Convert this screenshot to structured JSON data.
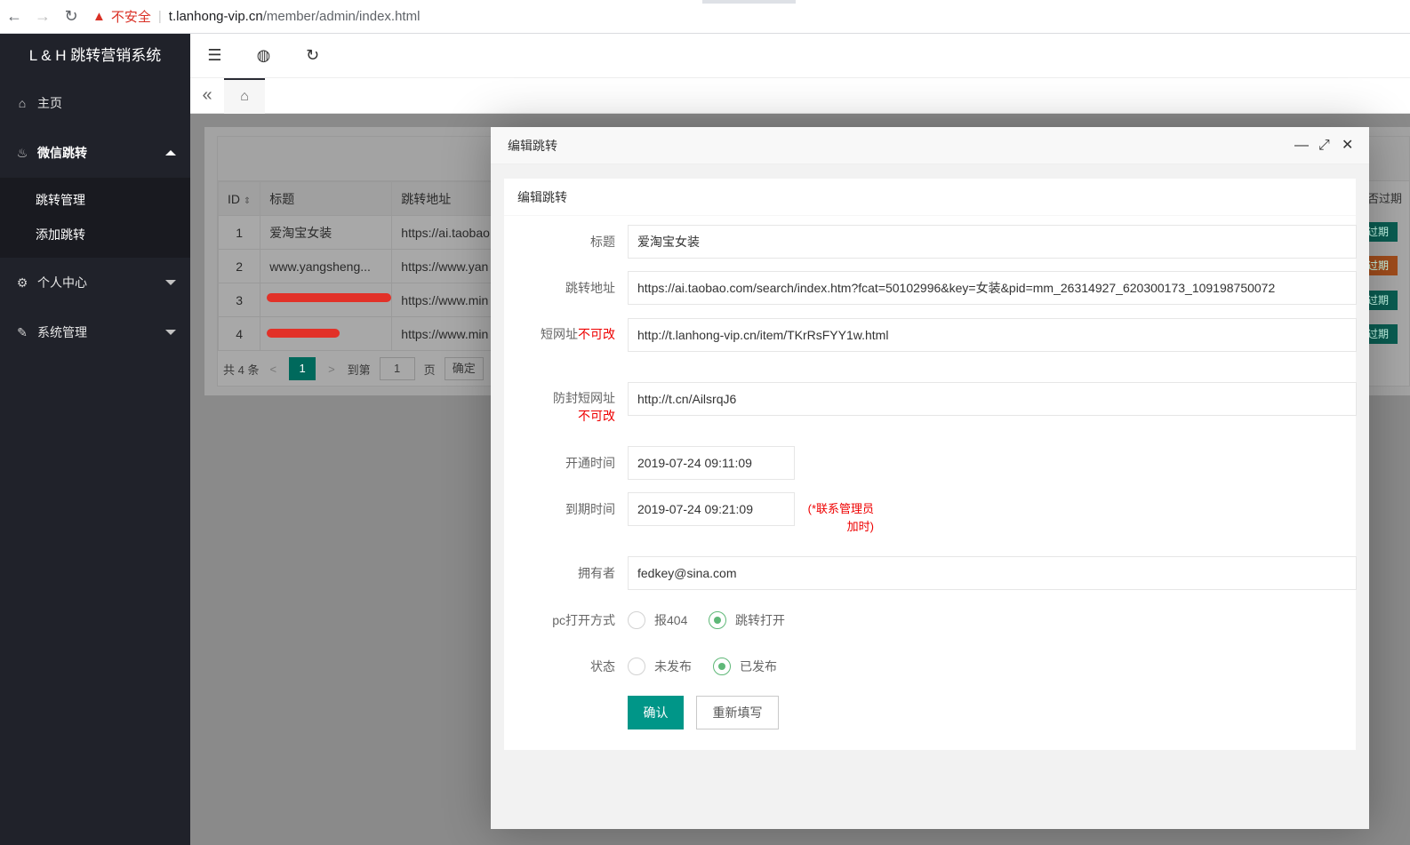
{
  "browser": {
    "back": "←",
    "forward": "→",
    "reload": "↻",
    "warning_icon": "▲",
    "insecure_label": "不安全",
    "host": "t.lanhong-vip.cn",
    "path": "/member/admin/index.html"
  },
  "sidebar": {
    "logo": "L & H 跳转营销系统",
    "items": [
      {
        "label": "主页",
        "icon": "home-icon"
      },
      {
        "label": "微信跳转",
        "icon": "fire-icon"
      },
      {
        "label": "个人中心",
        "icon": "gear-icon"
      },
      {
        "label": "系统管理",
        "icon": "wrench-icon"
      }
    ],
    "subitems": [
      "跳转管理",
      "添加跳转"
    ]
  },
  "topbar": {
    "menu_icon": "☰",
    "globe_icon": "◍",
    "refresh_icon": "↻"
  },
  "tabsbar": {
    "collapse_icon": "«",
    "home_icon": "⌂"
  },
  "table": {
    "headers": [
      "ID",
      "标题",
      "跳转地址"
    ],
    "rows": [
      {
        "id": "1",
        "title": "爱淘宝女装",
        "url": "https://ai.taobao"
      },
      {
        "id": "2",
        "title": "www.yangsheng...",
        "url": "https://www.yan"
      },
      {
        "id": "3",
        "title": "",
        "url": "https://www.min"
      },
      {
        "id": "4",
        "title": "",
        "url": "https://www.min"
      }
    ],
    "right_header": "否过期",
    "badges": [
      "过期",
      "过期",
      "过期",
      "过期"
    ],
    "pager": {
      "prev": "<",
      "total": "共 4 条",
      "current": "1",
      "next": ">",
      "goto_label": "到第",
      "goto_value": "1",
      "page_label": "页",
      "confirm": "确定"
    }
  },
  "modal": {
    "title": "编辑跳转",
    "controls": {
      "minimize": "—",
      "maximize": "⤢",
      "close": "✕"
    },
    "card_title": "编辑跳转",
    "fields": {
      "title_label": "标题",
      "title_value": "爱淘宝女装",
      "url_label": "跳转地址",
      "url_value": "https://ai.taobao.com/search/index.htm?fcat=50102996&key=女装&pid=mm_26314927_620300173_109198750072",
      "short_label": "短网址",
      "short_label_red": "不可改",
      "short_value": "http://t.lanhong-vip.cn/item/TKrRsFYY1w.html",
      "anti_label": "防封短网址",
      "anti_label_red": "不可改",
      "anti_value": "http://t.cn/AilsrqJ6",
      "open_label": "开通时间",
      "open_value": "2019-07-24 09:11:09",
      "expire_label": "到期时间",
      "expire_value": "2019-07-24 09:21:09",
      "expire_note": "(*联系管理员加时)",
      "owner_label": "拥有者",
      "owner_value": "fedkey@sina.com",
      "pc_label": "pc打开方式",
      "pc_options": [
        "报404",
        "跳转打开"
      ],
      "pc_selected": "跳转打开",
      "status_label": "状态",
      "status_options": [
        "未发布",
        "已发布"
      ],
      "status_selected": "已发布"
    },
    "buttons": {
      "confirm": "确认",
      "reset": "重新填写"
    }
  },
  "colors": {
    "primary": "#009688",
    "sidebar": "#20222a",
    "danger": "#e00000",
    "radio_on": "#5fb878"
  }
}
